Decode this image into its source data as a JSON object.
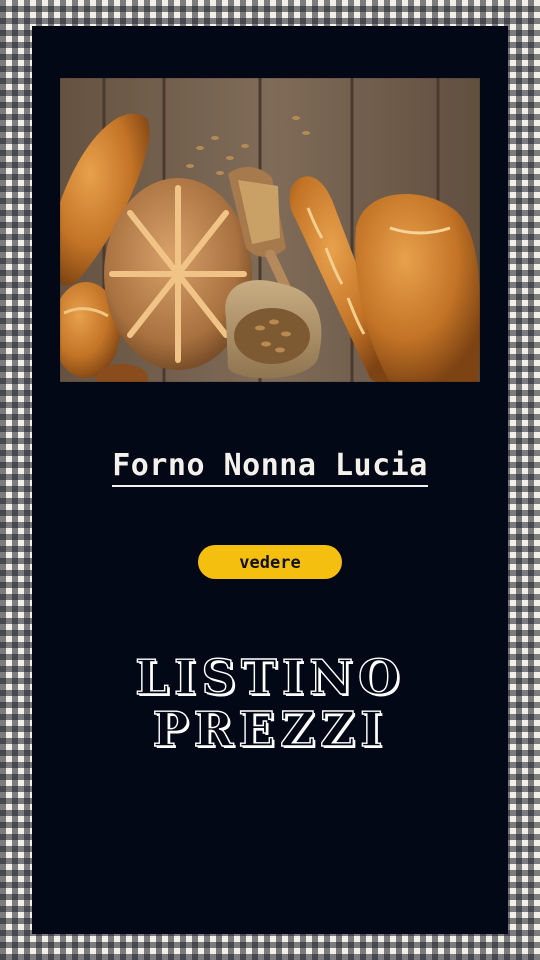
{
  "card": {
    "title": "Forno Nonna Lucia",
    "button_label": "vedere",
    "headline_line1": "LISTINO",
    "headline_line2": "PREZZI"
  },
  "colors": {
    "panel": "#030816",
    "button": "#f5bf10",
    "text": "#f4f1ea",
    "check_light": "#f2efe6",
    "check_dark": "#1c1e28"
  },
  "image": {
    "icon": "bread-photo"
  }
}
